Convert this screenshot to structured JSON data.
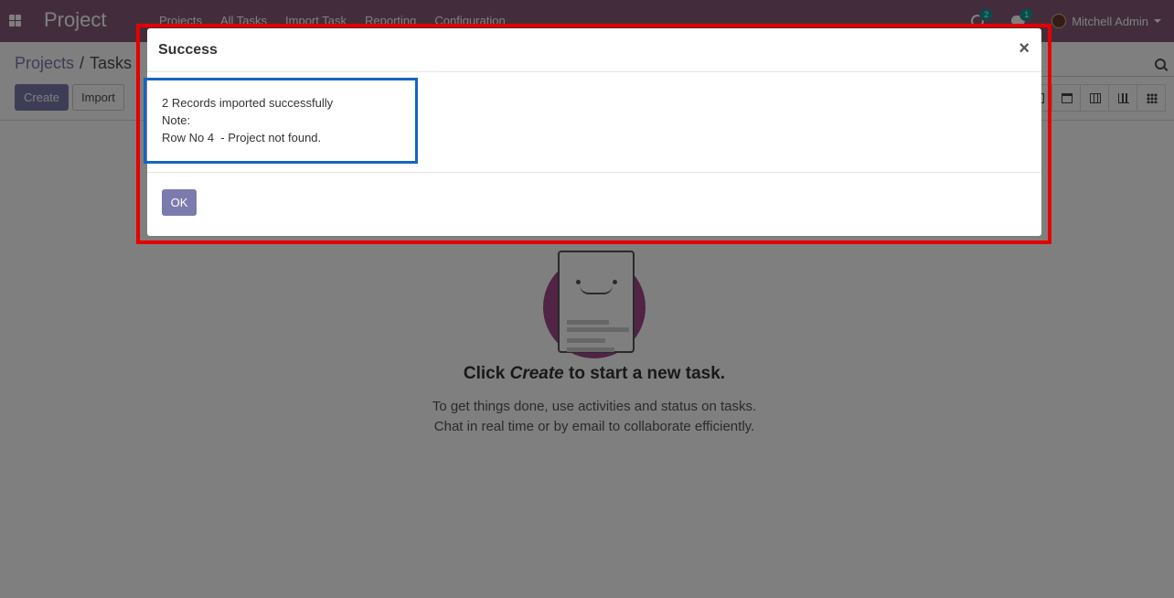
{
  "navbar": {
    "brand": "Project",
    "menu": [
      "Projects",
      "All Tasks",
      "Import Task",
      "Reporting",
      "Configuration"
    ],
    "activity_count": "2",
    "messages_count": "1",
    "user_name": "Mitchell Admin"
  },
  "control_panel": {
    "breadcrumb_parent": "Projects",
    "breadcrumb_separator": "/",
    "breadcrumb_current": "Tasks",
    "create_label": "Create",
    "import_label": "Import"
  },
  "helper": {
    "title_before": "Click ",
    "title_emphasis": "Create",
    "title_after": " to start a new task.",
    "line1": "To get things done, use activities and status on tasks.",
    "line2": "Chat in real time or by email to collaborate efficiently."
  },
  "modal": {
    "title": "Success",
    "close_symbol": "×",
    "message_line1": "2 Records imported successfully",
    "message_line2": "Note:",
    "message_line3": "Row No 4  - Project not found.",
    "ok_label": "OK"
  },
  "colors": {
    "navbar": "#875a7b",
    "primary_button": "#7c7bad",
    "highlight_red": "#e50000",
    "highlight_blue": "#1565c0"
  }
}
